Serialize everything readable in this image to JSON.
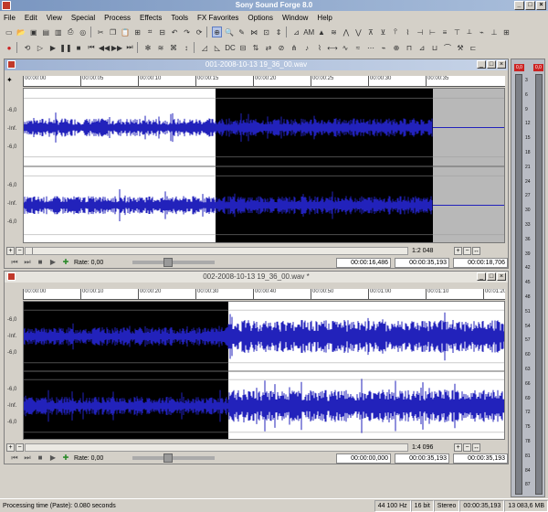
{
  "window": {
    "title": "Sony Sound Forge 8.0"
  },
  "menu": [
    "File",
    "Edit",
    "View",
    "Special",
    "Process",
    "Effects",
    "Tools",
    "FX Favorites",
    "Options",
    "Window",
    "Help"
  ],
  "toolbar": {
    "am_label": "AM",
    "dc_label": "DC"
  },
  "doc1": {
    "title": "001-2008-10-13 19_36_00.wav",
    "ruler_ticks": [
      "00:00:00",
      "00:00:05",
      "00:00:10",
      "00:00:15",
      "00:00:20",
      "00:00:25",
      "00:00:30",
      "00:00:35"
    ],
    "levels": [
      "-6,0",
      "-Inf.",
      "-6,0",
      "-6,0",
      "-Inf.",
      "-6,0"
    ],
    "zoom_ratio": "1:2 048",
    "rate_label": "Rate: 0,00",
    "time_cursor": "00:00:16,486",
    "time_selection": "00:00:35,193",
    "time_length": "00:00:18,706"
  },
  "doc2": {
    "title": "002-2008-10-13 19_36_00.wav *",
    "ruler_ticks": [
      "00:00:00",
      "00:00:10",
      "00:00:20",
      "00:00:30",
      "00:00:40",
      "00:00:50",
      "00:01:00",
      "00:01:10",
      "00:01:20"
    ],
    "levels": [
      "-6,0",
      "-Inf.",
      "-6,0",
      "-6,0",
      "-Inf.",
      "-6,0"
    ],
    "zoom_ratio": "1:4 096",
    "rate_label": "Rate: 0,00",
    "time_cursor": "00:00:00,000",
    "time_selection": "00:00:35,193",
    "time_length": "00:00:35,193"
  },
  "vu": {
    "peak_left": "0,0",
    "peak_right": "0,0",
    "scale": [
      "3",
      "6",
      "9",
      "12",
      "15",
      "18",
      "21",
      "24",
      "27",
      "30",
      "33",
      "36",
      "39",
      "42",
      "45",
      "48",
      "51",
      "54",
      "57",
      "60",
      "63",
      "66",
      "69",
      "72",
      "75",
      "78",
      "81",
      "84",
      "87"
    ]
  },
  "status": {
    "message": "Processing time (Paste): 0.080 seconds",
    "sample_rate": "44 100 Hz",
    "bit_depth": "16 bit",
    "channels": "Stereo",
    "length": "00:00:35,193",
    "free_space": "13 083,6 MB"
  },
  "colors": {
    "waveform": "#2222bb",
    "selection_bg": "#000000",
    "title_active": "#7a96c0"
  }
}
